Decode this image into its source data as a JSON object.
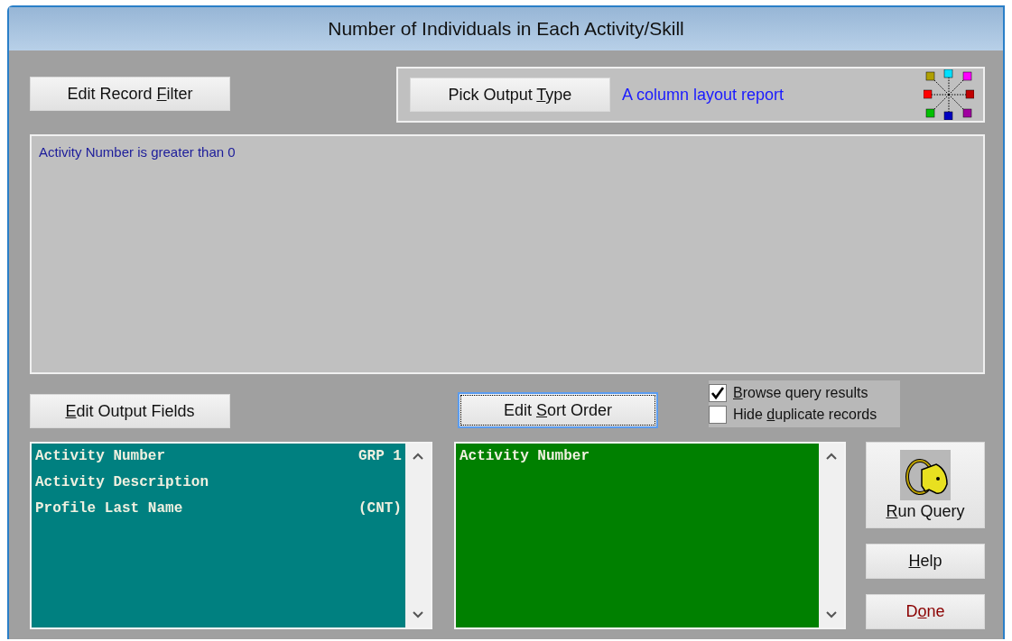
{
  "window": {
    "title": "Number of Individuals in Each Activity/Skill"
  },
  "filter_button": {
    "before": "Edit Record ",
    "key": "F",
    "after": "ilter"
  },
  "output_type": {
    "button": {
      "before": "Pick Output ",
      "key": "T",
      "after": "ype"
    },
    "description": "A column layout report"
  },
  "filter_text": "Activity Number is greater than 0",
  "output_fields_button": {
    "key": "E",
    "after": "dit Output Fields"
  },
  "sort_order_button": {
    "before": "Edit ",
    "key": "S",
    "after": "ort Order",
    "focused": true
  },
  "options": [
    {
      "key": "B",
      "after": "rowse query results",
      "checked": true
    },
    {
      "before": "Hide ",
      "key": "d",
      "after": "uplicate records",
      "checked": false
    }
  ],
  "output_fields": [
    {
      "name": "Activity Number",
      "tag": "GRP 1"
    },
    {
      "name": "Activity Description"
    },
    {
      "name": "Profile Last Name",
      "tag": "(CNT)"
    }
  ],
  "sort_fields": [
    {
      "name": "Activity Number"
    }
  ],
  "actions": [
    {
      "kind": "run",
      "key": "R",
      "after": "un Query"
    },
    {
      "kind": "help",
      "key": "H",
      "after": "elp"
    },
    {
      "kind": "done",
      "before": "D",
      "key": "o",
      "after": "ne"
    }
  ]
}
